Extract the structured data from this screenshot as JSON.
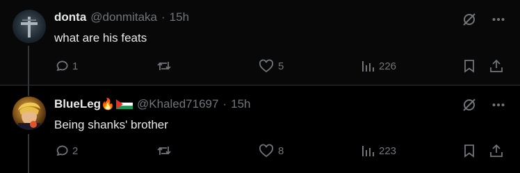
{
  "tweets": [
    {
      "name": "donta",
      "handle": "@donmitaka",
      "separator": "·",
      "time": "15h",
      "text": "what are his feats",
      "replies": "1",
      "retweets": "",
      "likes": "5",
      "views": "226"
    },
    {
      "name": "BlueLeg",
      "name_emoji": "🔥",
      "handle": "@Khaled71697",
      "separator": "·",
      "time": "15h",
      "text": "Being shanks' brother",
      "replies": "2",
      "retweets": "",
      "likes": "8",
      "views": "223"
    }
  ],
  "icons": {
    "grok": "grok-slash-icon",
    "more": "more-dots-icon",
    "reply": "reply-bubble-icon",
    "retweet": "retweet-icon",
    "like": "heart-icon",
    "views": "views-bars-icon",
    "bookmark": "bookmark-icon",
    "share": "share-icon"
  },
  "colors": {
    "background": "#000000",
    "text": "#e7e9ea",
    "muted": "#71767b"
  }
}
